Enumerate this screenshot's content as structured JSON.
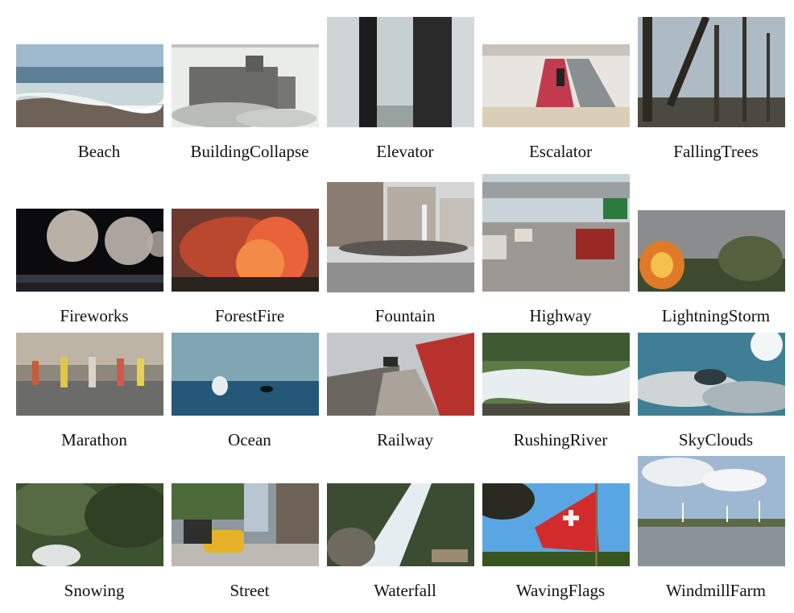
{
  "scenes": [
    {
      "label": "Beach"
    },
    {
      "label": "BuildingCollapse"
    },
    {
      "label": "Elevator"
    },
    {
      "label": "Escalator"
    },
    {
      "label": "FallingTrees"
    },
    {
      "label": "Fireworks"
    },
    {
      "label": "ForestFire"
    },
    {
      "label": "Fountain"
    },
    {
      "label": "Highway"
    },
    {
      "label": "LightningStorm"
    },
    {
      "label": "Marathon"
    },
    {
      "label": "Ocean"
    },
    {
      "label": "Railway"
    },
    {
      "label": "RushingRiver"
    },
    {
      "label": "SkyClouds"
    },
    {
      "label": "Snowing"
    },
    {
      "label": "Street"
    },
    {
      "label": "Waterfall"
    },
    {
      "label": "WavingFlags"
    },
    {
      "label": "WindmillFarm"
    }
  ]
}
